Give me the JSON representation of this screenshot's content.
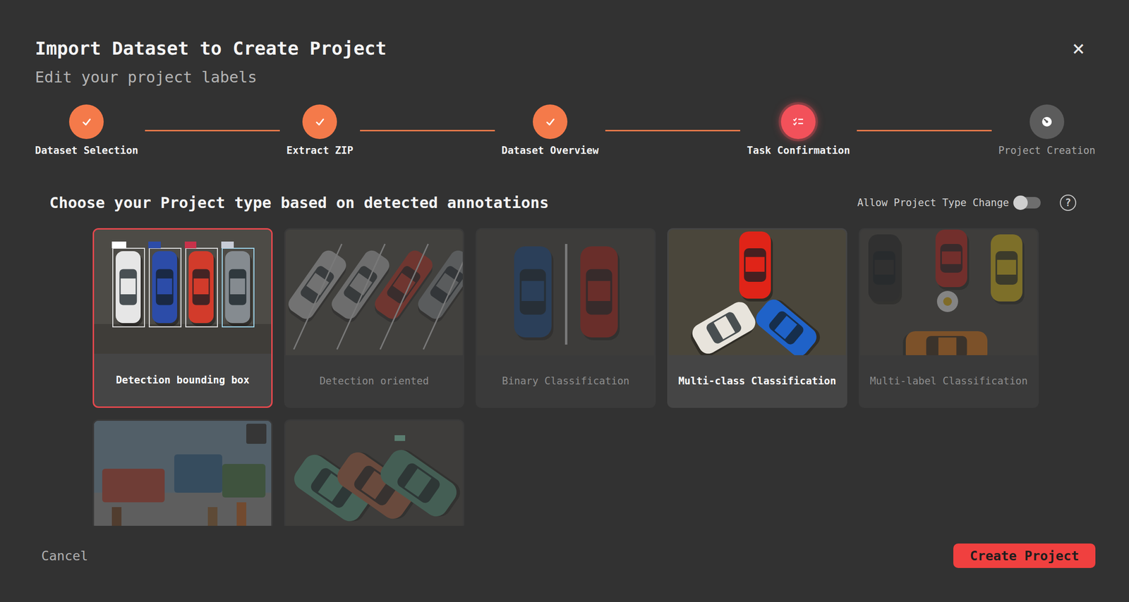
{
  "dialog": {
    "title": "Import Dataset to Create Project",
    "subtitle": "Edit your project labels",
    "close": "×"
  },
  "steps": [
    {
      "label": "Dataset Selection",
      "kind": "done"
    },
    {
      "label": "Extract ZIP",
      "kind": "done"
    },
    {
      "label": "Dataset Overview",
      "kind": "done"
    },
    {
      "label": "Task Confirmation",
      "kind": "active"
    },
    {
      "label": "Project Creation",
      "kind": "pending"
    }
  ],
  "section": {
    "heading": "Choose your Project type based on detected annotations",
    "toggle": {
      "label": "Allow Project Type Change",
      "on": false
    },
    "help": "?"
  },
  "cards": [
    {
      "label": "Detection bounding box",
      "selected": true,
      "disabled": false
    },
    {
      "label": "Detection oriented",
      "selected": false,
      "disabled": true
    },
    {
      "label": "Binary Classification",
      "selected": false,
      "disabled": true
    },
    {
      "label": "Multi-class Classification",
      "selected": false,
      "disabled": false
    },
    {
      "label": "Multi-label Classification",
      "selected": false,
      "disabled": true
    },
    {
      "selected": false,
      "disabled": true
    },
    {
      "selected": false,
      "disabled": true
    }
  ],
  "footer": {
    "cancel": "Cancel",
    "create": "Create Project"
  }
}
